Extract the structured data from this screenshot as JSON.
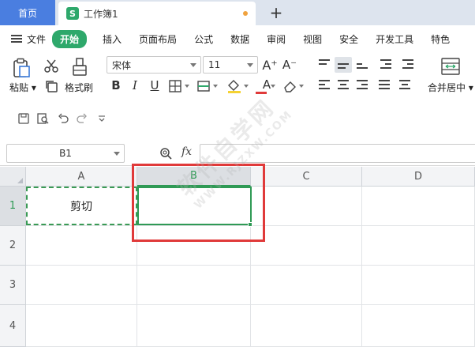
{
  "tabs": {
    "home": "首页",
    "doc_icon": "S",
    "doc_name": "工作簿1",
    "new_tab": "+"
  },
  "menu": {
    "file": "文件",
    "items": [
      "开始",
      "插入",
      "页面布局",
      "公式",
      "数据",
      "审阅",
      "视图",
      "安全",
      "开发工具",
      "特色"
    ]
  },
  "ribbon": {
    "paste": "粘贴",
    "format_painter": "格式刷",
    "font_name": "宋体",
    "font_size": "11",
    "bold": "B",
    "italic": "I",
    "underline": "U",
    "font_color_letter": "A",
    "grow_font": "A⁺",
    "shrink_font": "A⁻",
    "merge_center": "合并居中",
    "font_color": "#e03a3a",
    "fill_color": "#f5d232"
  },
  "formula_bar": {
    "name_box": "B1",
    "fx": "fx",
    "value": ""
  },
  "grid": {
    "columns": [
      "A",
      "B",
      "C",
      "D"
    ],
    "rows": [
      "1",
      "2",
      "3",
      "4"
    ],
    "cells": {
      "A1": "剪切"
    },
    "selected_column": "B",
    "selected_row": "1"
  },
  "watermark": {
    "text": "软件自学网",
    "url": "WWW.RJZXW.COM"
  },
  "colors": {
    "accent_green": "#2ea86b",
    "highlight_red": "#e03a3a",
    "home_tab_blue": "#4a7ee0"
  }
}
